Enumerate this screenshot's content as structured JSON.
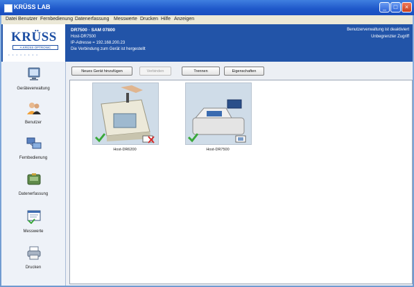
{
  "window": {
    "title": "KRÜSS LAB"
  },
  "menu": [
    "Datei",
    "Benutzer",
    "Fernbedienung",
    "Datenerfassung",
    "Messwerte",
    "Drucken",
    "Hilfe",
    "Anzeigen"
  ],
  "header": {
    "brand": "KRÜSS",
    "brand_sub": "A.KRÜSS OPTRONIC",
    "line1": "DR7500 · SAM 07800",
    "line2": "Host-DR7500",
    "line3": "IP-Adresse = 192.168.200.23",
    "line4": "Die Verbindung zum Gerät ist hergestellt",
    "right1": "Benutzerverwaltung ist deaktiviert",
    "right2": "Unbegrenzter Zugriff"
  },
  "sidebar": {
    "items": [
      {
        "label": "Geräteverwaltung",
        "icon": "monitor-icon"
      },
      {
        "label": "Benutzer",
        "icon": "users-icon"
      },
      {
        "label": "Fernbedienung",
        "icon": "remote-control-icon"
      },
      {
        "label": "Datenerfassung",
        "icon": "data-collection-icon"
      },
      {
        "label": "Messwerte",
        "icon": "measurements-icon"
      },
      {
        "label": "Drucken",
        "icon": "printer-icon"
      }
    ]
  },
  "toolbar": {
    "new_device": "Neues Gerät hinzufügen",
    "connect": "Verbinden",
    "disconnect": "Trennen",
    "properties": "Eigenschaften"
  },
  "devices": [
    {
      "label": "Host-DR6200",
      "connected": true,
      "status": "error",
      "colors": {
        "body": "#e9e6d6",
        "screen": "#8fb0c8"
      }
    },
    {
      "label": "Host-DR7500",
      "connected": true,
      "status": "network",
      "colors": {
        "body": "#dcdcdc",
        "screen": "#3a6bb0"
      }
    }
  ],
  "colors": {
    "accent": "#2254a8",
    "titlebar": "#1e57c9",
    "ok": "#3aa83a",
    "error": "#d62a2a"
  }
}
